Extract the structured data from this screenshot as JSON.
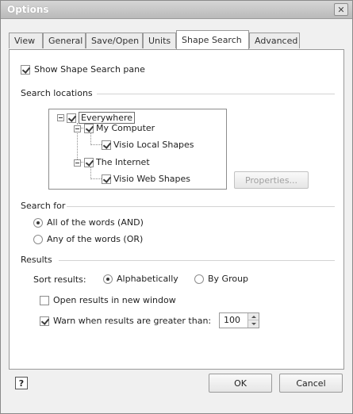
{
  "window": {
    "title": "Options",
    "close_glyph": "✕"
  },
  "tabs": [
    {
      "label": "View"
    },
    {
      "label": "General"
    },
    {
      "label": "Save/Open"
    },
    {
      "label": "Units"
    },
    {
      "label": "Shape Search",
      "active": true
    },
    {
      "label": "Advanced"
    }
  ],
  "show_pane": {
    "label": "Show Shape Search pane",
    "checked": true
  },
  "search_locations": {
    "heading": "Search locations",
    "tree": [
      {
        "label": "Everywhere",
        "checked": true
      },
      {
        "label": "My Computer",
        "checked": true
      },
      {
        "label": "Visio Local Shapes",
        "checked": true
      },
      {
        "label": "The Internet",
        "checked": true
      },
      {
        "label": "Visio Web Shapes",
        "checked": true
      }
    ],
    "properties_button": "Properties..."
  },
  "search_for": {
    "heading": "Search for",
    "options": [
      {
        "label": "All of the words (AND)",
        "selected": true
      },
      {
        "label": "Any of the words (OR)",
        "selected": false
      }
    ]
  },
  "results": {
    "heading": "Results",
    "sort_label": "Sort results:",
    "sort_options": [
      {
        "label": "Alphabetically",
        "selected": true
      },
      {
        "label": "By Group",
        "selected": false
      }
    ],
    "open_new_window": {
      "label": "Open results in new window",
      "checked": false
    },
    "warn": {
      "label": "Warn when results are greater than:",
      "checked": true,
      "value": "100"
    }
  },
  "footer": {
    "help_glyph": "?",
    "ok_label": "OK",
    "cancel_label": "Cancel"
  },
  "colors": {
    "dialog_bg": "#f0f0f0",
    "panel_bg": "#ffffff",
    "border": "#9a9a9a"
  }
}
